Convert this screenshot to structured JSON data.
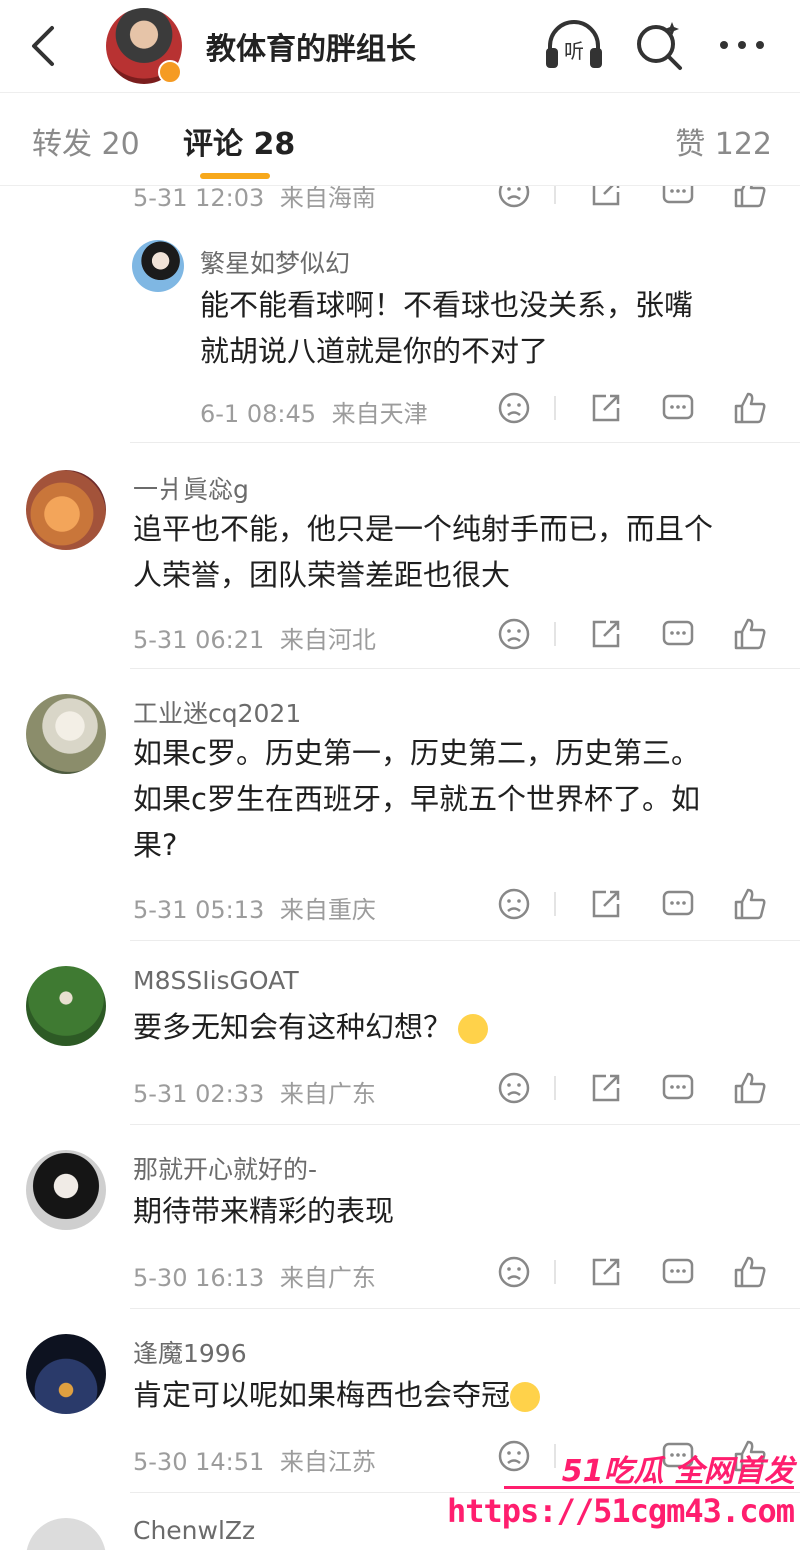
{
  "header": {
    "nickname": "教体育的胖组长",
    "listen_label": "听"
  },
  "tabs": [
    {
      "label": "转发 20"
    },
    {
      "label": "评论 28"
    },
    {
      "label": "赞 122"
    }
  ],
  "top_meta": {
    "time": "5-31 12:03",
    "location": "来自海南"
  },
  "reply": {
    "name": "繁星如梦似幻",
    "text_line1": "能不能看球啊！不看球也没关系，张嘴",
    "text_line2": "就胡说八道就是你的不对了",
    "time": "6-1 08:45",
    "location": "来自天津"
  },
  "comments": [
    {
      "name": "一爿眞惢g",
      "lines": [
        "追平也不能，他只是一个纯射手而已，而且个",
        "人荣誉，团队荣誉差距也很大"
      ],
      "time": "5-31 06:21",
      "location": "来自河北"
    },
    {
      "name": "工业迷cq2021",
      "lines": [
        "如果c罗。历史第一，历史第二，历史第三。",
        "如果c罗生在西班牙，早就五个世界杯了。如",
        "果?"
      ],
      "time": "5-31 05:13",
      "location": "来自重庆"
    },
    {
      "name": "M8SSIisGOAT",
      "lines": [
        "要多无知会有这种幻想？"
      ],
      "time": "5-31 02:33",
      "location": "来自广东"
    },
    {
      "name": "那就开心就好的-",
      "lines": [
        "期待带来精彩的表现"
      ],
      "time": "5-30 16:13",
      "location": "来自广东"
    },
    {
      "name": "逢魔1996",
      "lines": [
        "肯定可以呢如果梅西也会夺冠"
      ],
      "time": "5-30 14:51",
      "location": "来自江苏"
    },
    {
      "name": "ChenwlZz",
      "lines": [],
      "time": "",
      "location": ""
    }
  ],
  "watermark": {
    "brand": "51吃瓜 全网首发",
    "url": "https://51cgm43.com"
  }
}
